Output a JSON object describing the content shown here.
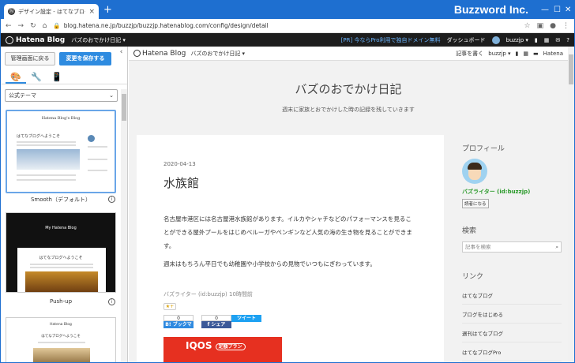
{
  "browser": {
    "tab_title": "デザイン設定 - はてなブログ",
    "brand": "Buzzword Inc.",
    "url": "blog.hatena.ne.jp/buzzjp/buzzjp.hatenablog.com/config/design/detail"
  },
  "hatena_bar": {
    "logo": "Hatena Blog",
    "blog_menu": "バズのおでかけ日記 ▾",
    "promo": "[PR] 今ならPro利用で独自ドメイン無料",
    "dashboard": "ダッシュボード",
    "user": "buzzjp ▾"
  },
  "editor": {
    "back_button": "管理画面に戻る",
    "save_button": "変更を保存する",
    "theme_select": "公式テーマ",
    "themes": [
      {
        "label": "Smooth（デフォルト）",
        "preview_title": "Hatena Blog's Blog",
        "preview_heading": "はてなブログへようこそ"
      },
      {
        "label": "Push-up",
        "preview_title": "My Hatena Blog",
        "preview_heading": "はてなブログへようこそ"
      },
      {
        "label": "",
        "preview_title": "Hatena Blog",
        "preview_heading": "はてなブログへようこそ"
      }
    ]
  },
  "preview": {
    "topbar": {
      "logo": "Hatena Blog",
      "blog_menu": "バズのおでかけ日記 ▾",
      "write": "記事を書く",
      "user": "buzzjp ▾",
      "brand": "Hatena"
    },
    "blog_title": "バズのおでかけ日記",
    "blog_subtitle": "週末に家族とおでかけした時の記録を残していきます",
    "entry": {
      "date": "2020-04-13",
      "title": "水族館",
      "paragraphs": [
        "名古屋市港区には名古屋港水族館があります。イルカやシャチなどのパフォーマンスを見ることができる屋外プールをはじめベルーガやペンギンなど人気の海の生き物を見ることができます。",
        "週末はもちろん平日でも幼稚園や小学校からの見物でいつもにぎわっています。"
      ],
      "author": "バズライター (id:buzzjp) 10時間前",
      "bookmark_count": "0",
      "bookmark_label": "B! ブックマーク",
      "share_count": "0",
      "share_label": "f シェア",
      "tweet_label": "ツイート",
      "ad_text": "IQOS",
      "ad_badge": "定額プラン"
    },
    "sidebar": {
      "profile_heading": "プロフィール",
      "profile_name": "バズライター (id:buzzjp)",
      "reader_button": "読者になる",
      "search_heading": "検索",
      "search_placeholder": "記事を検索",
      "links_heading": "リンク",
      "links": [
        "はてなブログ",
        "ブログをはじめる",
        "週刊はてなブログ",
        "はてなブログPro"
      ]
    }
  }
}
